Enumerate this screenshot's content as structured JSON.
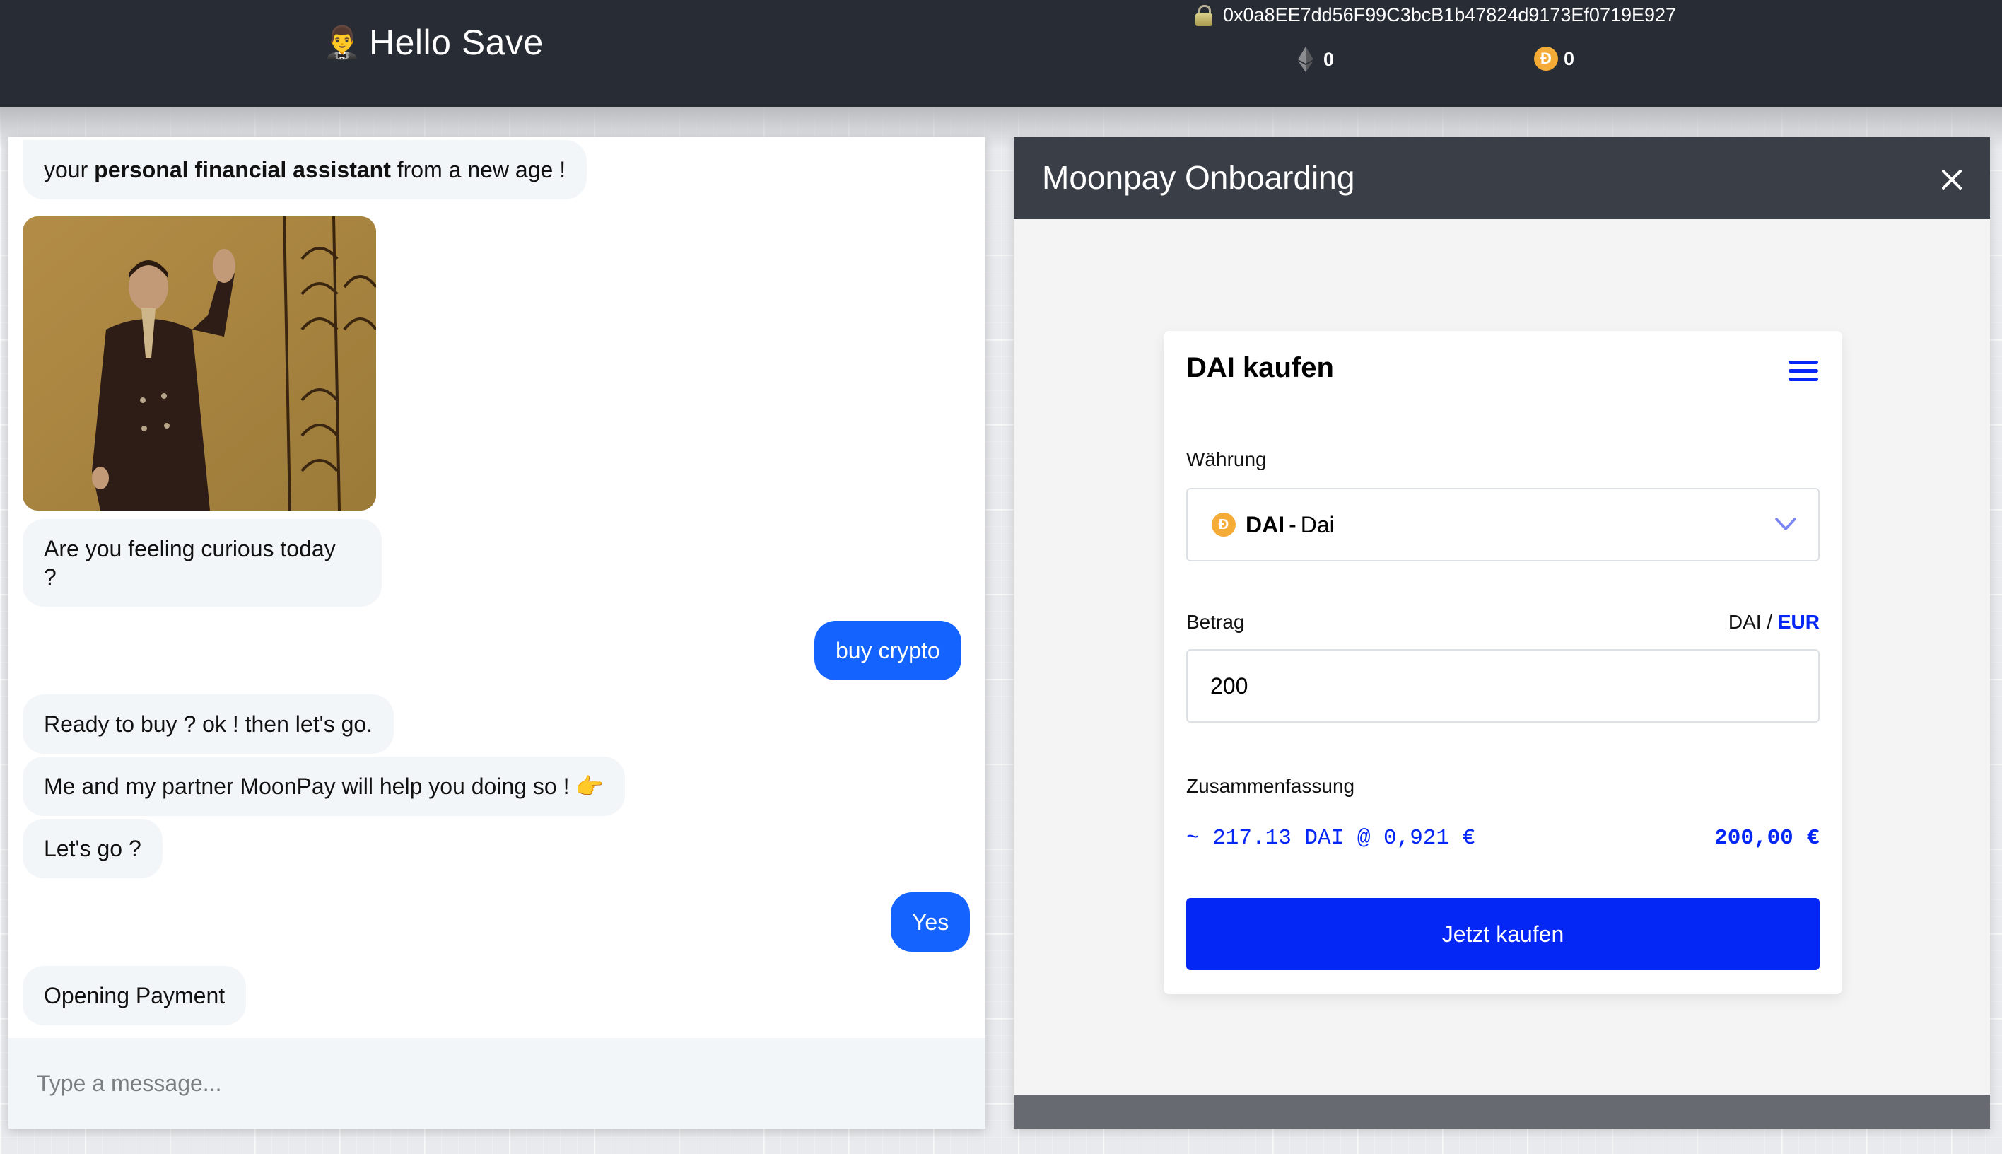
{
  "header": {
    "brand_emoji": "🤵‍♂️",
    "title": "Hello Save",
    "wallet_address": "0x0a8EE7dd56F99C3bcB1b47824d9173Ef0719E927",
    "balances": [
      {
        "asset": "ETH",
        "icon": "ethereum-icon",
        "value": "0"
      },
      {
        "asset": "DAI",
        "icon": "dai-icon",
        "value": "0"
      }
    ]
  },
  "chat": {
    "messages": [
      {
        "from": "bot",
        "parts": [
          "your ",
          "personal financial assistant",
          " from a new age !"
        ]
      },
      {
        "from": "bot",
        "type": "image",
        "alt": "man in suit waving gif"
      },
      {
        "from": "bot",
        "text_line1": "Are you feeling curious today",
        "text_line2": "?"
      },
      {
        "from": "user",
        "text": "buy crypto"
      },
      {
        "from": "bot",
        "text": "Ready to buy ? ok ! then let's go."
      },
      {
        "from": "bot",
        "text": "Me and my partner MoonPay will help you doing so ! 👉"
      },
      {
        "from": "bot",
        "text": "Let's go ?"
      },
      {
        "from": "user",
        "text": "Yes"
      },
      {
        "from": "bot",
        "text": "Opening Payment"
      }
    ],
    "input_placeholder": "Type a message...",
    "input_value": ""
  },
  "modal": {
    "title": "Moonpay Onboarding",
    "widget": {
      "title": "DAI kaufen",
      "currency_label": "Währung",
      "currency_symbol": "DAI",
      "currency_separator": "-",
      "currency_name": "Dai",
      "amount_label": "Betrag",
      "unit_inactive": "DAI",
      "unit_divider": " / ",
      "unit_active": "EUR",
      "amount_value": "200",
      "summary_label": "Zusammenfassung",
      "summary_quote": "~ 217.13 DAI @ 0,921 €",
      "summary_total": "200,00 €",
      "buy_label": "Jetzt kaufen"
    }
  },
  "colors": {
    "header_bg": "#282c35",
    "user_bubble": "#1463ff",
    "bot_bubble": "#f3f6f9",
    "moonpay_blue": "#0527f5",
    "dai_gold": "#f5ac37",
    "modal_header": "#3a3e46"
  }
}
